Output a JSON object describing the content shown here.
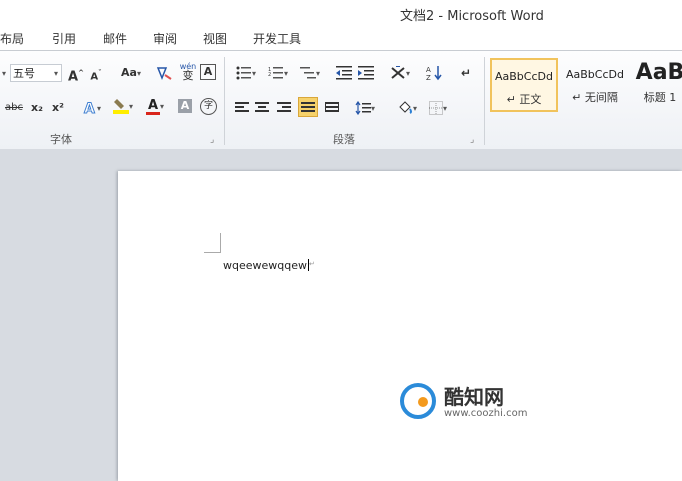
{
  "window": {
    "title": "文档2 - Microsoft Word"
  },
  "tabs": [
    "页面布局",
    "引用",
    "邮件",
    "审阅",
    "视图",
    "开发工具"
  ],
  "font_group": {
    "size_value": "五号",
    "grow_label": "A",
    "shrink_label": "A",
    "change_case_label": "Aa",
    "pinyin_label": "wén",
    "strike_label": "abc",
    "subscript_label": "x₂",
    "superscript_label": "x²",
    "font_color_label": "A",
    "char_shading_label": "A",
    "enclose_label": "字",
    "group_label": "字体"
  },
  "paragraph_group": {
    "group_label": "段落"
  },
  "styles": [
    {
      "sample": "AaBbCcDd",
      "name": "↵ 正文",
      "selected": true
    },
    {
      "sample": "AaBbCcDd",
      "name": "↵ 无间隔",
      "selected": false
    },
    {
      "sample": "AaB",
      "name": "标题 1",
      "selected": false
    }
  ],
  "document": {
    "text": "wqeewewqqew"
  },
  "watermark": {
    "name": "酷知网",
    "url": "www.coozhi.com"
  },
  "colors": {
    "accent_yellow": "#f1c35c",
    "font_red": "#d9261c",
    "highlight_yellow": "#ffee00"
  }
}
